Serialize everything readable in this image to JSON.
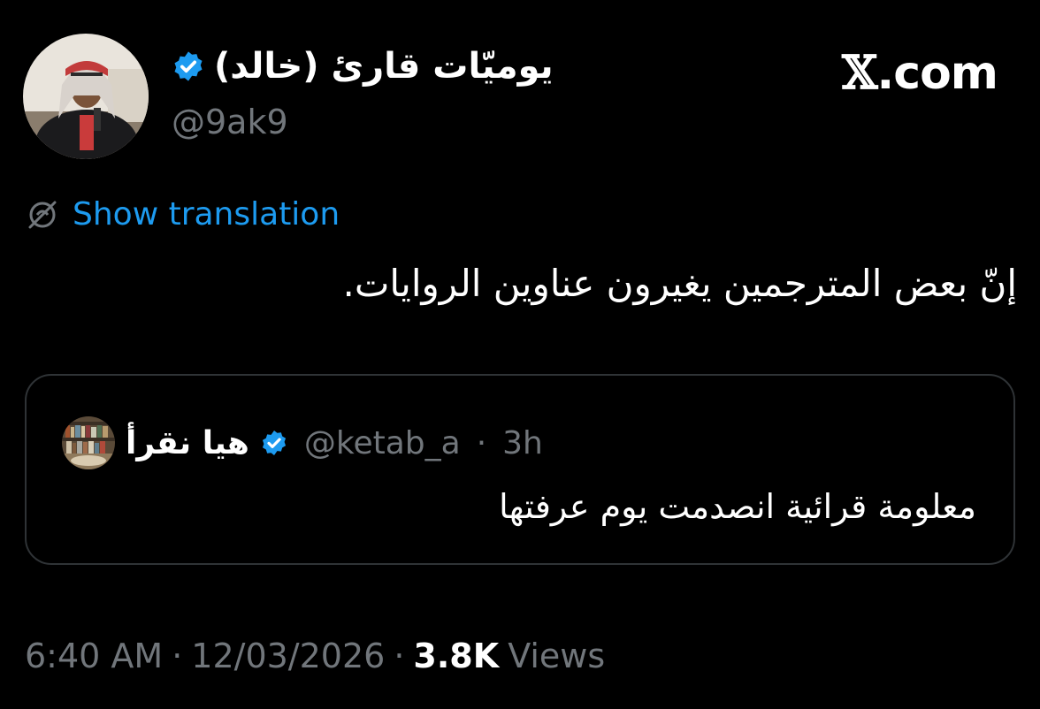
{
  "author": {
    "display_name": "يوميّات قارئ (خالد)",
    "handle": "@9ak9",
    "verified": true,
    "avatar_icon": "user-photo"
  },
  "brand": {
    "x_mark": "𝕏",
    "domain": ".com"
  },
  "translation": {
    "label": "Show translation",
    "icon": "globe-off-icon"
  },
  "tweet": {
    "text": "إنّ بعض المترجمين يغيرون عناوين الروايات."
  },
  "quote": {
    "display_name": "هيا نقرأ",
    "verified": true,
    "handle": "@ketab_a",
    "separator": "·",
    "time": "3h",
    "text": "معلومة قرائية انصدمت يوم عرفتها"
  },
  "footer": {
    "time": "6:40 AM",
    "sep1": "·",
    "date": "12/03/2026",
    "sep2": "·",
    "views_count": "3.8K",
    "views_label": "Views"
  },
  "colors": {
    "background": "#000000",
    "link": "#1d9bf0",
    "verified": "#1d9bf0",
    "secondary_text": "#71767b",
    "border": "#2f3336"
  }
}
